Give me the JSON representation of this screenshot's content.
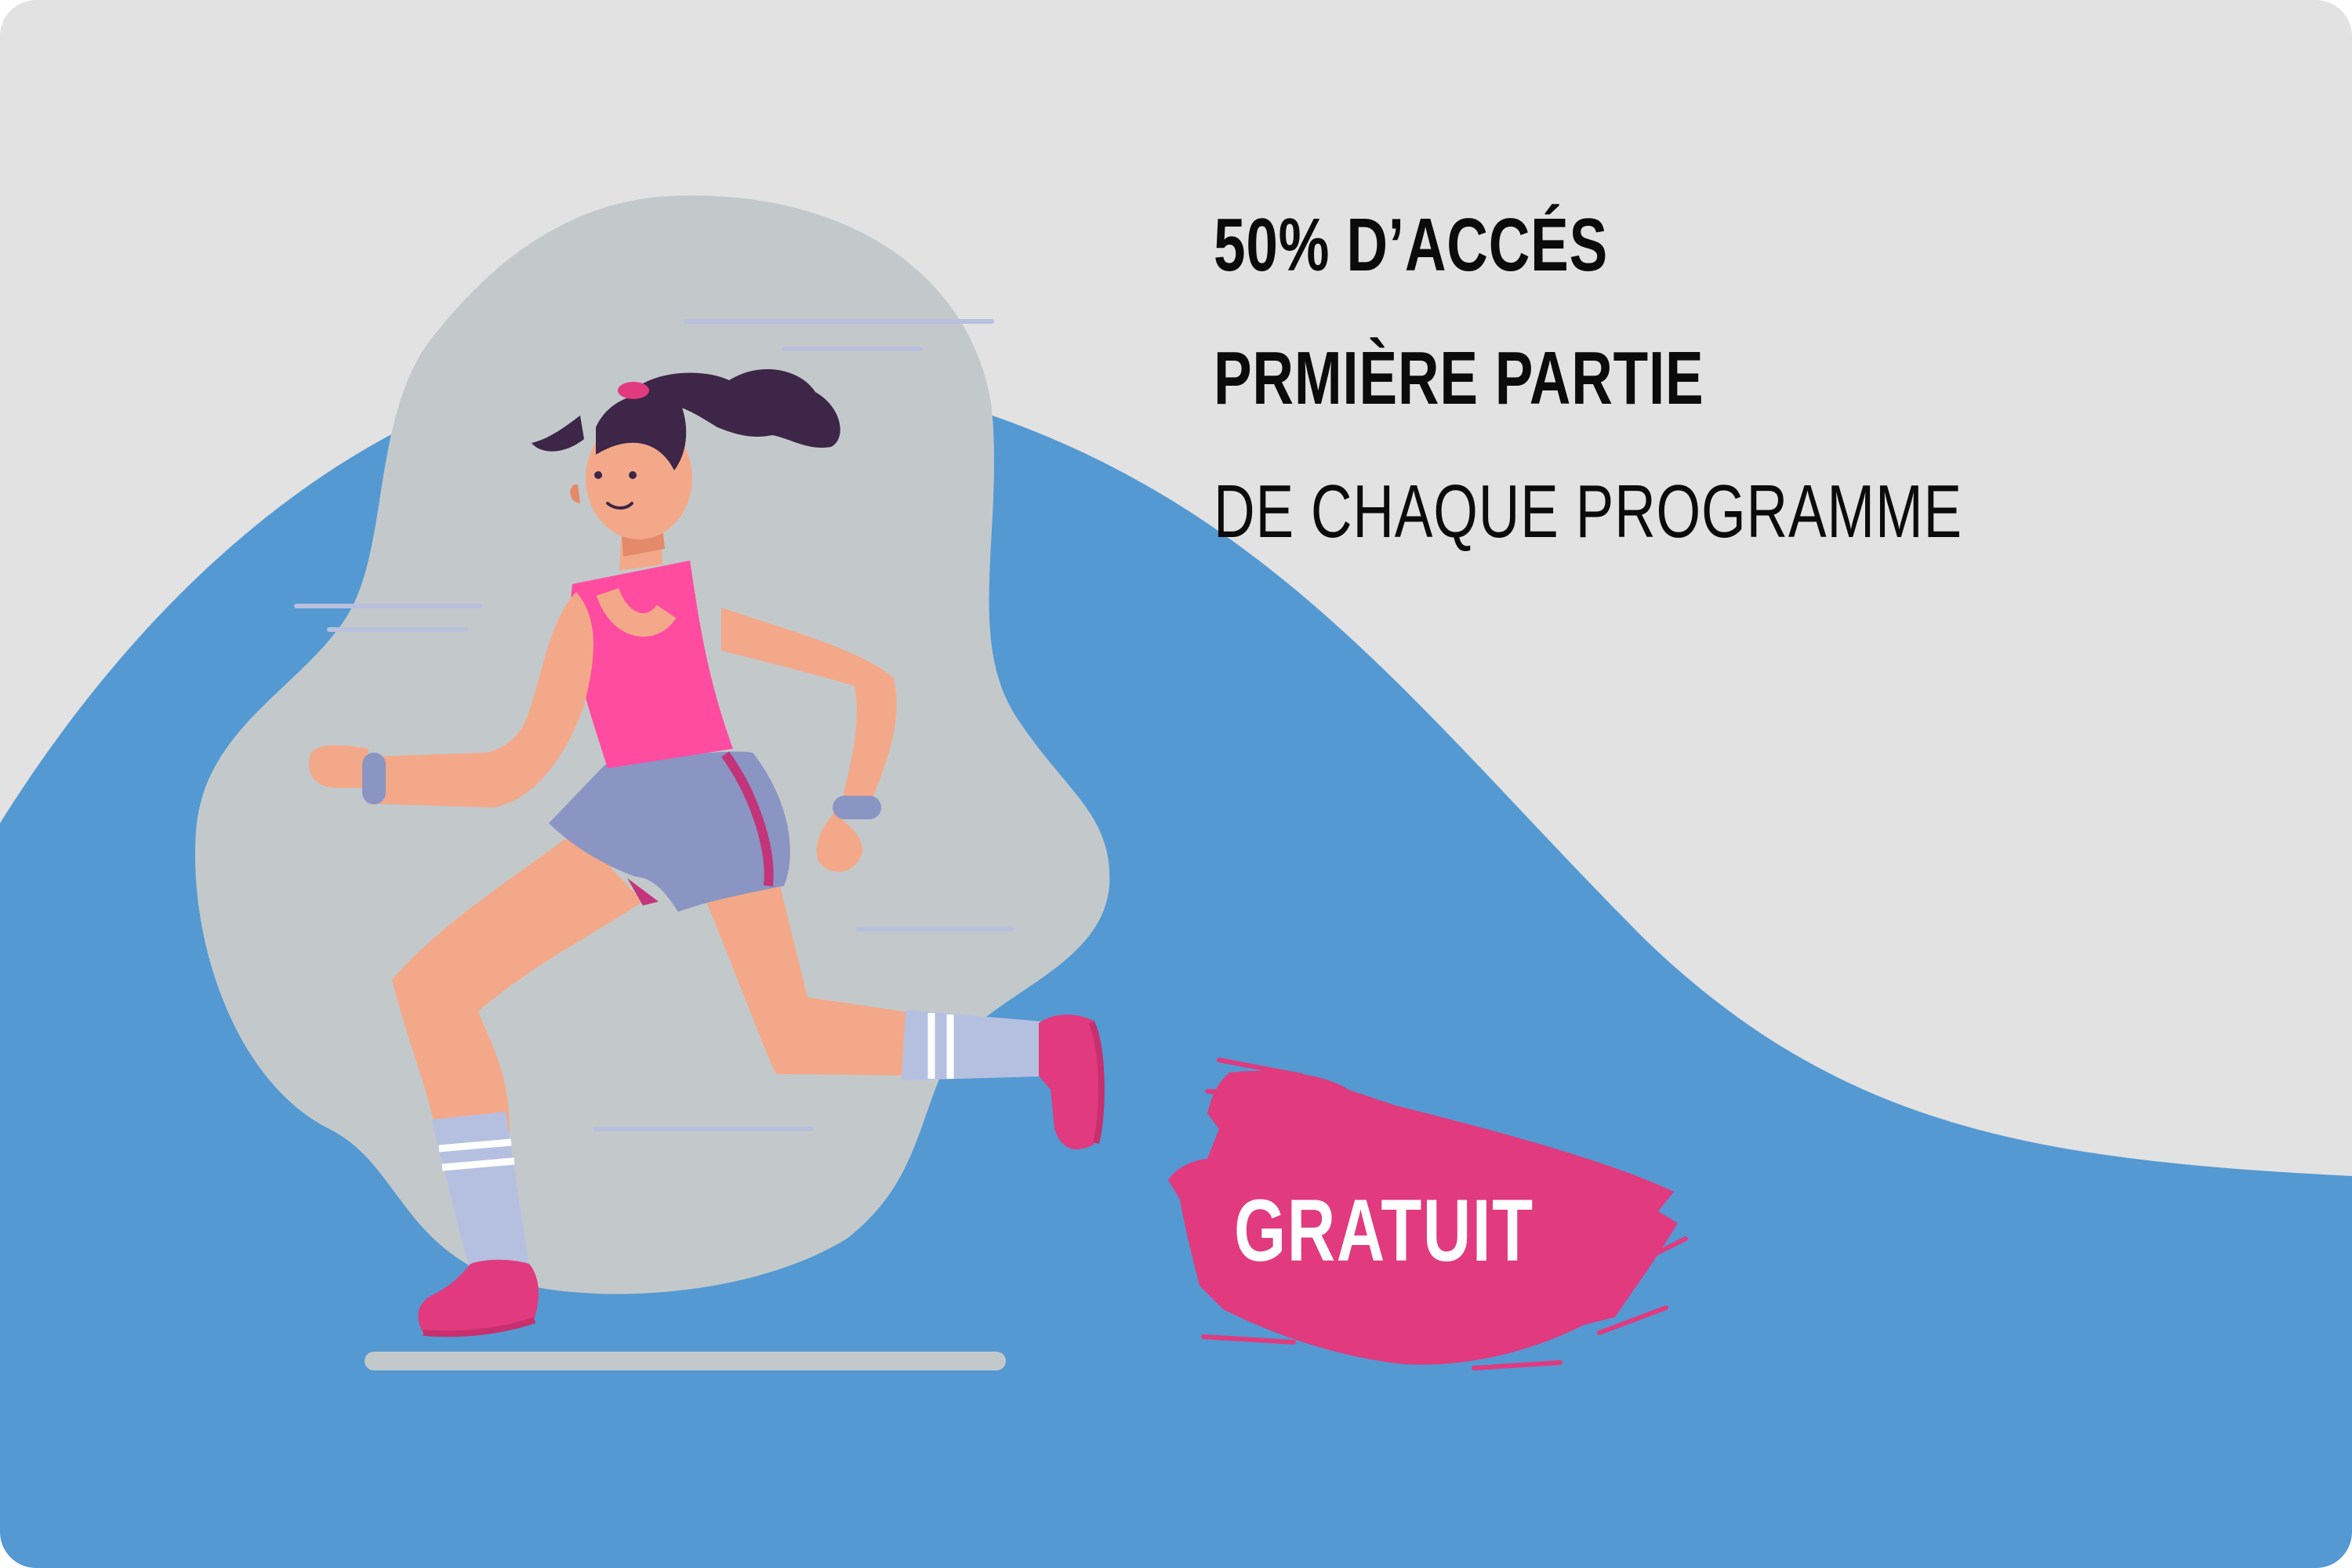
{
  "promo": {
    "headline_line1": "50% D’ACCÉS",
    "headline_line2": "PRMIÈRE PARTIE",
    "headline_line3": "DE CHAQUE PROGRAMME",
    "badge_label": "GRATUIT"
  },
  "illustration": {
    "subject": "running-woman",
    "icons": [
      "running-woman-illustration",
      "paint-brush-stroke",
      "motion-lines"
    ]
  },
  "colors": {
    "background_grey": "#e2e2e2",
    "wave_blue": "#5499d2",
    "blob_grey": "#c3c9cb",
    "accent_pink": "#e13a7e",
    "text_dark": "#0b0b0b",
    "skin": "#f3a989",
    "hair": "#3d2647",
    "shorts": "#8a95c4",
    "socks": "#b5c0e1"
  }
}
